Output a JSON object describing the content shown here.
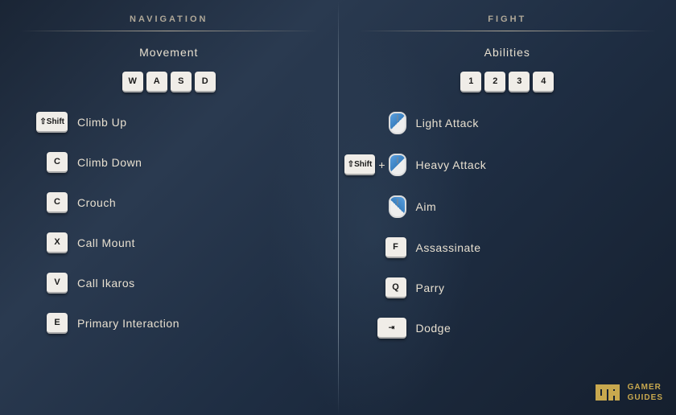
{
  "sections": {
    "navigation": {
      "title": "NAVIGATION",
      "subsection": "Movement",
      "wasd": [
        "W",
        "A",
        "S",
        "D"
      ],
      "actions": [
        {
          "key": "Shift",
          "key_type": "shift",
          "label": "Climb Up"
        },
        {
          "key": "C",
          "key_type": "single",
          "label": "Climb Down"
        },
        {
          "key": "C",
          "key_type": "single",
          "label": "Crouch"
        },
        {
          "key": "X",
          "key_type": "single",
          "label": "Call Mount"
        },
        {
          "key": "V",
          "key_type": "single",
          "label": "Call Ikaros"
        },
        {
          "key": "E",
          "key_type": "single",
          "label": "Primary Interaction"
        }
      ]
    },
    "fight": {
      "title": "FIGHT",
      "subsection": "Abilities",
      "nums": [
        "1",
        "2",
        "3",
        "4"
      ],
      "actions": [
        {
          "key": "mouse_left",
          "key_type": "mouse_left",
          "label": "Light Attack"
        },
        {
          "key": "Shift+mouse_left",
          "key_type": "shift_mouse_left",
          "label": "Heavy Attack"
        },
        {
          "key": "mouse_right",
          "key_type": "mouse_right",
          "label": "Aim"
        },
        {
          "key": "F",
          "key_type": "single",
          "label": "Assassinate"
        },
        {
          "key": "Q",
          "key_type": "single",
          "label": "Parry"
        },
        {
          "key": "Tab",
          "key_type": "tab",
          "label": "Dodge"
        }
      ]
    }
  },
  "logo": {
    "text": "GAMER\nGUIDES"
  }
}
